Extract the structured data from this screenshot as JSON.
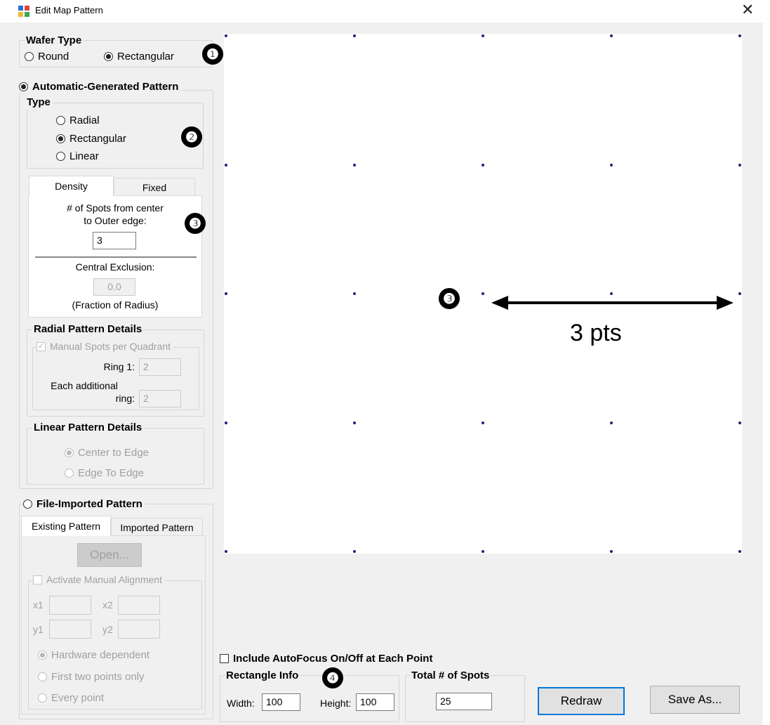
{
  "window": {
    "title": "Edit Map Pattern",
    "close_icon": "✕"
  },
  "wafer_type": {
    "legend": "Wafer Type",
    "options": [
      {
        "label": "Round",
        "selected": false
      },
      {
        "label": "Rectangular",
        "selected": true
      }
    ]
  },
  "automatic": {
    "label": "Automatic-Generated Pattern",
    "selected": true,
    "type": {
      "legend": "Type",
      "options": [
        {
          "label": "Radial",
          "selected": false
        },
        {
          "label": "Rectangular",
          "selected": true
        },
        {
          "label": "Linear",
          "selected": false
        }
      ]
    },
    "tabs": [
      {
        "label": "Density",
        "active": true
      },
      {
        "label": "Fixed",
        "active": false
      }
    ],
    "density": {
      "spots_label_line1": "# of Spots from center",
      "spots_label_line2": "to Outer edge:",
      "spots_value": "3",
      "exclusion_label": "Central Exclusion:",
      "exclusion_value": "0.0",
      "exclusion_unit": "(Fraction of Radius)"
    },
    "radial_details": {
      "legend": "Radial Pattern Details",
      "manual_spots_label": "Manual Spots per Quadrant",
      "manual_spots_checked": true,
      "ring1_label": "Ring 1:",
      "ring1_value": "2",
      "each_additional_line1": "Each additional",
      "each_additional_line2": "ring:",
      "each_additional_value": "2"
    },
    "linear_details": {
      "legend": "Linear Pattern Details",
      "options": [
        {
          "label": "Center to Edge",
          "selected": true
        },
        {
          "label": "Edge To Edge",
          "selected": false
        }
      ]
    }
  },
  "file_imported": {
    "label": "File-Imported Pattern",
    "selected": false,
    "tabs": [
      {
        "label": "Existing Pattern",
        "active": true
      },
      {
        "label": "Imported Pattern",
        "active": false
      }
    ],
    "open_button": "Open...",
    "manual_alignment": {
      "legend": "Activate Manual Alignment",
      "checked": false,
      "x1_label": "x1",
      "x2_label": "x2",
      "y1_label": "y1",
      "y2_label": "y2",
      "x1_value": "",
      "x2_value": "",
      "y1_value": "",
      "y2_value": "",
      "options": [
        {
          "label": "Hardware dependent",
          "selected": true
        },
        {
          "label": "First two points only",
          "selected": false
        },
        {
          "label": "Every point",
          "selected": false
        }
      ]
    }
  },
  "autofocus": {
    "label": "Include AutoFocus On/Off at Each Point",
    "checked": false
  },
  "rectangle_info": {
    "legend": "Rectangle Info",
    "width_label": "Width:",
    "width_value": "100",
    "height_label": "Height:",
    "height_value": "100"
  },
  "total_spots": {
    "legend": "Total # of Spots",
    "value": "25"
  },
  "buttons": {
    "redraw": "Redraw",
    "save_as": "Save As..."
  },
  "pattern_preview": {
    "grid_columns": 5,
    "grid_rows": 5,
    "spot_color": "#1a237e"
  },
  "annotations": {
    "badges": [
      "❶",
      "❷",
      "❸",
      "❸",
      "❹"
    ],
    "distance_label": "3 pts"
  }
}
